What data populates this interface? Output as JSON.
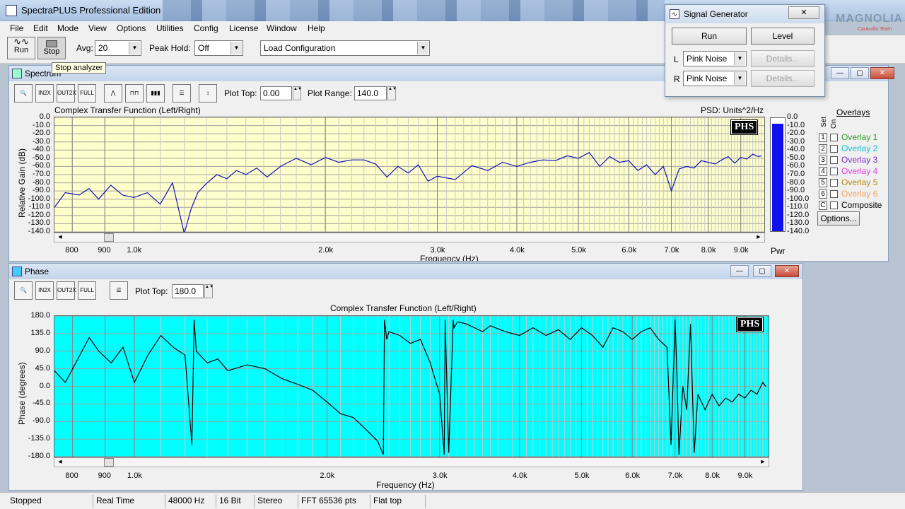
{
  "app": {
    "title": "SpectraPLUS Professional Edition"
  },
  "menu": [
    "File",
    "Edit",
    "Mode",
    "View",
    "Options",
    "Utilities",
    "Config",
    "License",
    "Window",
    "Help"
  ],
  "toolbar": {
    "run_label": "Run",
    "stop_label": "Stop",
    "avg_label": "Avg:",
    "avg_value": "20",
    "peak_label": "Peak Hold:",
    "peak_value": "Off",
    "config_value": "Load Configuration",
    "tooltip": "Stop analyzer"
  },
  "spectrum": {
    "title": "Spectrum",
    "plot_top_label": "Plot Top:",
    "plot_top_value": "0.00",
    "plot_range_label": "Plot Range:",
    "plot_range_value": "140.0",
    "chart_title": "Complex Transfer Function (Left/Right)",
    "psd_label": "PSD: Units^2/Hz",
    "pwr_label": "Pwr",
    "badge": "PHS",
    "overlays_title": "Overlays",
    "set_label": "Set",
    "on_label": "On",
    "options_label": "Options...",
    "overlays": [
      {
        "num": "1",
        "name": "Overlay 1",
        "color": "#2ca02c"
      },
      {
        "num": "2",
        "name": "Overlay 2",
        "color": "#17becf"
      },
      {
        "num": "3",
        "name": "Overlay 3",
        "color": "#7b2fbe"
      },
      {
        "num": "4",
        "name": "Overlay 4",
        "color": "#e040e0"
      },
      {
        "num": "5",
        "name": "Overlay 5",
        "color": "#b8860b"
      },
      {
        "num": "6",
        "name": "Overlay 6",
        "color": "#f4a460"
      },
      {
        "num": "C",
        "name": "Composite",
        "color": "#000000"
      }
    ]
  },
  "phase": {
    "title": "Phase",
    "plot_top_label": "Plot Top:",
    "plot_top_value": "180.0",
    "chart_title": "Complex Transfer Function (Left/Right)",
    "badge": "PHS"
  },
  "signal_generator": {
    "title": "Signal Generator",
    "run_label": "Run",
    "level_label": "Level",
    "l_label": "L",
    "r_label": "R",
    "l_value": "Pink Noise",
    "r_value": "Pink Noise",
    "details_label": "Details..."
  },
  "logo": {
    "text": "MAGNOLIA",
    "sub": "CarAudio Team"
  },
  "status": [
    "Stopped",
    "Real Time",
    "48000 Hz",
    "16 Bit",
    "Stereo",
    "FFT 65536 pts",
    "Flat top"
  ],
  "chart_data": [
    {
      "type": "line",
      "title": "Complex Transfer Function (Left/Right)",
      "xlabel": "Frequency (Hz)",
      "ylabel": "Relative Gain (dB)",
      "xlim": [
        750,
        9800
      ],
      "ylim": [
        -140,
        0
      ],
      "x_ticks": [
        "800",
        "900",
        "1.0k",
        "2.0k",
        "3.0k",
        "4.0k",
        "5.0k",
        "6.0k",
        "7.0k",
        "8.0k",
        "9.0k"
      ],
      "y_ticks": [
        "0.0",
        "-10.0",
        "-20.0",
        "-30.0",
        "-40.0",
        "-50.0",
        "-60.0",
        "-70.0",
        "-80.0",
        "-90.0",
        "-100.0",
        "-110.0",
        "-120.0",
        "-130.0",
        "-140.0"
      ],
      "grid": true,
      "series": [
        {
          "color": "#1010c0",
          "x": [
            750,
            780,
            820,
            850,
            880,
            920,
            960,
            1000,
            1050,
            1100,
            1150,
            1200,
            1230,
            1260,
            1300,
            1350,
            1400,
            1450,
            1500,
            1560,
            1620,
            1700,
            1800,
            1900,
            2000,
            2100,
            2200,
            2300,
            2400,
            2500,
            2600,
            2700,
            2800,
            2900,
            3000,
            3200,
            3400,
            3600,
            3800,
            4000,
            4200,
            4400,
            4600,
            4800,
            5000,
            5200,
            5400,
            5600,
            5800,
            6000,
            6200,
            6400,
            6600,
            6800,
            7000,
            7200,
            7400,
            7600,
            7800,
            8000,
            8200,
            8400,
            8600,
            8800,
            9000,
            9200,
            9400,
            9600,
            9700
          ],
          "y": [
            -110,
            -92,
            -95,
            -87,
            -100,
            -83,
            -95,
            -98,
            -92,
            -106,
            -80,
            -142,
            -112,
            -92,
            -81,
            -70,
            -75,
            -65,
            -70,
            -62,
            -73,
            -60,
            -50,
            -58,
            -49,
            -55,
            -52,
            -52,
            -57,
            -73,
            -60,
            -68,
            -58,
            -78,
            -72,
            -76,
            -59,
            -65,
            -55,
            -60,
            -55,
            -52,
            -53,
            -47,
            -50,
            -43,
            -60,
            -48,
            -55,
            -53,
            -65,
            -58,
            -70,
            -60,
            -90,
            -63,
            -60,
            -62,
            -53,
            -55,
            -57,
            -52,
            -48,
            -56,
            -49,
            -51,
            -45,
            -48,
            -47
          ]
        }
      ]
    },
    {
      "type": "line",
      "title": "Complex Transfer Function (Left/Right)",
      "xlabel": "Frequency (Hz)",
      "ylabel": "Phase (degrees)",
      "xlim": [
        750,
        9800
      ],
      "ylim": [
        -180,
        180
      ],
      "x_ticks": [
        "800",
        "900",
        "1.0k",
        "2.0k",
        "3.0k",
        "4.0k",
        "5.0k",
        "6.0k",
        "7.0k",
        "8.0k",
        "9.0k"
      ],
      "y_ticks": [
        "180.0",
        "135.0",
        "90.0",
        "45.0",
        "0.0",
        "-45.0",
        "-90.0",
        "-135.0",
        "-180.0"
      ],
      "grid": true,
      "series": [
        {
          "color": "#000000",
          "x": [
            750,
            780,
            810,
            850,
            880,
            920,
            960,
            1000,
            1050,
            1100,
            1150,
            1200,
            1230,
            1240,
            1250,
            1300,
            1350,
            1400,
            1500,
            1600,
            1700,
            1800,
            1900,
            2000,
            2100,
            2200,
            2300,
            2400,
            2450,
            2460,
            2480,
            2500,
            2600,
            2700,
            2800,
            2900,
            3000,
            3050,
            3060,
            3100,
            3150,
            3160,
            3200,
            3300,
            3400,
            3500,
            3600,
            3800,
            4000,
            4200,
            4400,
            4600,
            4800,
            5000,
            5200,
            5400,
            5600,
            5800,
            6000,
            6200,
            6400,
            6600,
            6800,
            6900,
            7000,
            7050,
            7100,
            7200,
            7300,
            7400,
            7500,
            7600,
            7800,
            8000,
            8200,
            8400,
            8600,
            8800,
            9000,
            9200,
            9400,
            9600,
            9700
          ],
          "y": [
            40,
            10,
            60,
            125,
            90,
            60,
            100,
            10,
            80,
            130,
            100,
            80,
            -150,
            170,
            90,
            60,
            70,
            40,
            55,
            45,
            20,
            5,
            -10,
            -40,
            -70,
            -80,
            -110,
            -140,
            -175,
            170,
            120,
            140,
            130,
            110,
            120,
            60,
            -20,
            -175,
            170,
            -170,
            170,
            150,
            165,
            160,
            150,
            140,
            155,
            140,
            130,
            150,
            130,
            145,
            120,
            150,
            130,
            100,
            150,
            140,
            120,
            140,
            150,
            120,
            100,
            -150,
            170,
            20,
            -175,
            0,
            -60,
            160,
            -170,
            -20,
            -60,
            -20,
            -50,
            -30,
            -40,
            -20,
            -30,
            -10,
            -20,
            10,
            0
          ]
        }
      ]
    }
  ]
}
